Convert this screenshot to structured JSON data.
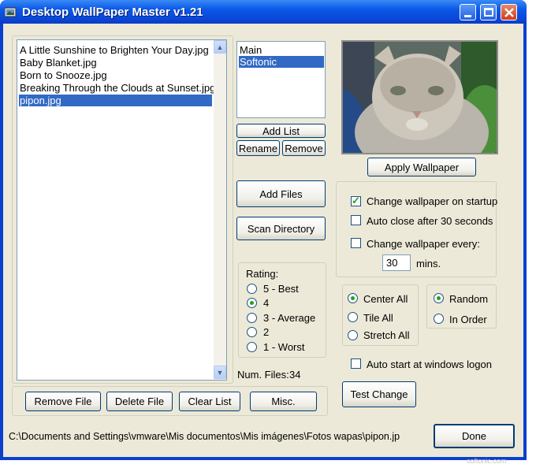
{
  "window": {
    "title": "Desktop WallPaper Master v1.21"
  },
  "files": {
    "items": [
      "A Little Sunshine to Brighten Your Day.jpg",
      "Baby Blanket.jpg",
      "Born to Snooze.jpg",
      "Breaking Through the Clouds at Sunset.jpg",
      "pipon.jpg"
    ],
    "selected": "pipon.jpg"
  },
  "lists": {
    "items": [
      "Main",
      "Softonic"
    ],
    "selected": "Softonic"
  },
  "buttons": {
    "add_list": "Add List",
    "rename": "Rename",
    "remove": "Remove",
    "add_files": "Add Files",
    "scan_directory": "Scan Directory",
    "apply_wallpaper": "Apply Wallpaper",
    "remove_file": "Remove File",
    "delete_file": "Delete File",
    "clear_list": "Clear List",
    "misc": "Misc.",
    "test_change": "Test Change",
    "done": "Done"
  },
  "rating": {
    "label": "Rating:",
    "options": [
      "5 - Best",
      "4",
      "3 - Average",
      "2",
      "1 - Worst"
    ],
    "selected": "4"
  },
  "num_files": {
    "label": "Num. Files:",
    "value": "34"
  },
  "options": {
    "change_on_startup": {
      "label": "Change wallpaper on startup",
      "checked": true
    },
    "auto_close": {
      "label": "Auto close after 30 seconds",
      "checked": false
    },
    "change_every": {
      "label": "Change wallpaper every:",
      "checked": false
    },
    "interval_value": "30",
    "interval_unit": "mins."
  },
  "layout_mode": {
    "options": [
      "Center All",
      "Tile All",
      "Stretch All"
    ],
    "selected": "Center All"
  },
  "order_mode": {
    "options": [
      "Random",
      "In Order"
    ],
    "selected": "Random"
  },
  "auto_start": {
    "label": "Auto start at windows logon",
    "checked": false
  },
  "status": {
    "path": "C:\\Documents and Settings\\vmware\\Mis documentos\\Mis imágenes\\Fotos wapas\\pipon.jp"
  },
  "watermark": "softonic.com",
  "colors": {
    "title_bar": "#0a58e8",
    "selection": "#316ac5",
    "client": "#ece9d8"
  }
}
